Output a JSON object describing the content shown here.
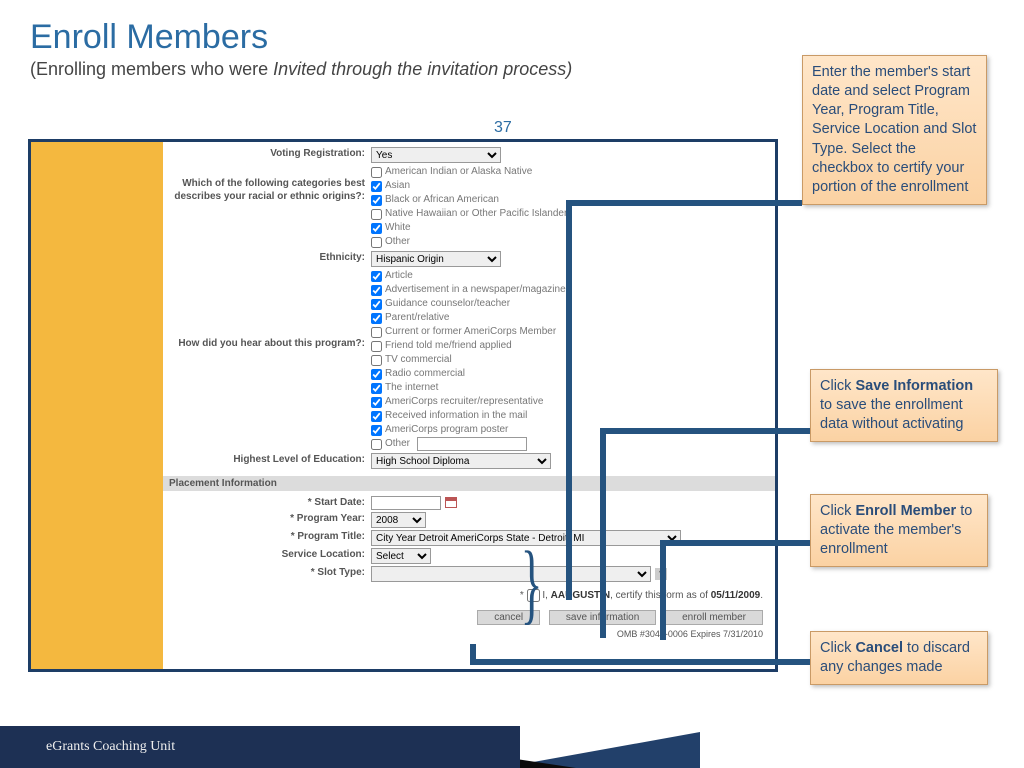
{
  "title": "Enroll Members",
  "subtitle_prefix": "(Enrolling members who were ",
  "subtitle_italic": "Invited through the invitation process)",
  "page_number": "37",
  "form": {
    "voting_label": "Voting Registration:",
    "voting_value": "Yes",
    "racial_label": "Which of the following categories   best describes your racial or   ethnic origins?:",
    "racial_opts": [
      {
        "label": "American Indian or Alaska Native",
        "checked": false
      },
      {
        "label": "Asian",
        "checked": true
      },
      {
        "label": "Black or African American",
        "checked": true
      },
      {
        "label": "Native Hawaiian or Other Pacific Islander",
        "checked": false
      },
      {
        "label": "White",
        "checked": true
      },
      {
        "label": "Other",
        "checked": false
      }
    ],
    "ethnicity_label": "Ethnicity:",
    "ethnicity_value": "Hispanic Origin",
    "hear_label": "How did you hear about this program?:",
    "hear_opts": [
      {
        "label": "Article",
        "checked": true
      },
      {
        "label": "Advertisement in a newspaper/magazine",
        "checked": true
      },
      {
        "label": "Guidance counselor/teacher",
        "checked": true
      },
      {
        "label": "Parent/relative",
        "checked": true
      },
      {
        "label": "Current or former AmeriCorps Member",
        "checked": false
      },
      {
        "label": "Friend told me/friend applied",
        "checked": false
      },
      {
        "label": "TV commercial",
        "checked": false
      },
      {
        "label": "Radio commercial",
        "checked": true
      },
      {
        "label": "The internet",
        "checked": true
      },
      {
        "label": "AmeriCorps recruiter/representative",
        "checked": true
      },
      {
        "label": "Received information in the mail",
        "checked": true
      },
      {
        "label": "AmeriCorps program poster",
        "checked": true
      },
      {
        "label": "Other",
        "checked": false,
        "hasText": true
      }
    ],
    "education_label": "Highest Level of Education:",
    "education_value": "High School Diploma",
    "section_header": "Placement Information",
    "start_date_label": "* Start Date:",
    "program_year_label": "* Program Year:",
    "program_year_value": "2008",
    "program_title_label": "* Program Title:",
    "program_title_value": "City Year Detroit AmeriCorps State - Detroit, MI",
    "service_location_label": "Service Location:",
    "service_location_value": "Select",
    "slot_type_label": "* Slot Type:",
    "cert_prefix": "*",
    "cert_text_1": " I, ",
    "cert_name": "AAUGUSTIN",
    "cert_text_2": ", certify this form as of ",
    "cert_date": "05/11/2009",
    "cert_text_3": ".",
    "btn_cancel": "cancel",
    "btn_save": "save information",
    "btn_enroll": "enroll member",
    "omb": "OMB #3045-0006 Expires 7/31/2010"
  },
  "callouts": {
    "c1": "Enter the member's start date and select Program Year, Program Title, Service Location and Slot Type. Select the checkbox to certify your portion of the enrollment",
    "c2a": "Click ",
    "c2b": "Save Information",
    "c2c": " to save the enrollment data without activating",
    "c3a": "Click ",
    "c3b": "Enroll Member",
    "c3c": " to activate the member's enrollment",
    "c4a": "Click ",
    "c4b": "Cancel",
    "c4c": " to discard any changes made"
  },
  "footer": "eGrants Coaching Unit"
}
